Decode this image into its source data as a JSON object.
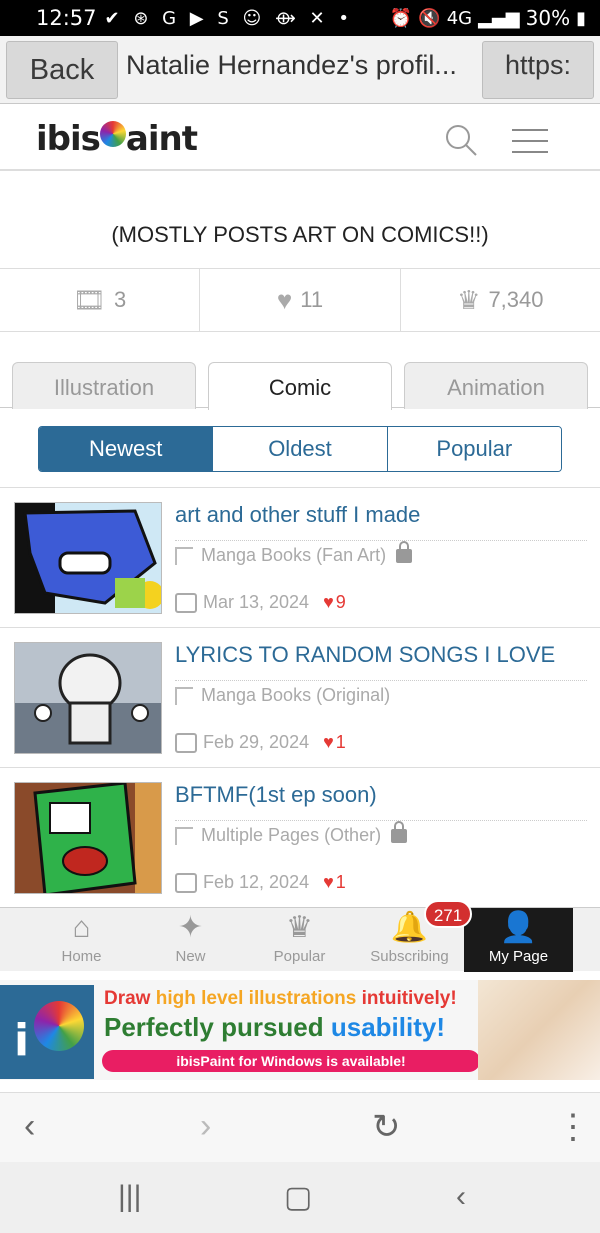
{
  "status": {
    "time": "12:57",
    "signal": "4G",
    "battery": "30%"
  },
  "browser": {
    "back_label": "Back",
    "tab_title": "Natalie Hernandez's profil...",
    "url_label": "https:"
  },
  "site": {
    "logo": "ibisPaint",
    "search_icon": "search-icon",
    "menu_icon": "hamburger-menu-icon"
  },
  "profile": {
    "bio": "(MOSTLY POSTS ART ON COMICS!!)"
  },
  "stats": {
    "works": "3",
    "likes": "11",
    "points": "7,340"
  },
  "tabs": [
    "Illustration",
    "Comic",
    "Animation"
  ],
  "active_tab": "Comic",
  "sorts": [
    "Newest",
    "Oldest",
    "Popular"
  ],
  "active_sort": "Newest",
  "posts": [
    {
      "title": "art and other stuff I made",
      "category": "Manga Books (Fan Art)",
      "locked": true,
      "date": "Mar 13, 2024",
      "likes": "9"
    },
    {
      "title": "LYRICS TO RANDOM SONGS I LOVE",
      "category": "Manga Books (Original)",
      "locked": false,
      "date": "Feb 29, 2024",
      "likes": "1"
    },
    {
      "title": "BFTMF(1st ep soon)",
      "category": "Multiple Pages (Other)",
      "locked": true,
      "date": "Feb 12, 2024",
      "likes": "1"
    }
  ],
  "bottom_nav": {
    "home": "Home",
    "new": "New",
    "popular": "Popular",
    "subscribing": "Subscribing",
    "my_page": "My Page",
    "badge": "271"
  },
  "ad": {
    "line1_a": "Draw ",
    "line1_b": "high level illustrations",
    "line1_c": " intuitively!",
    "line2_a": "Perfectly pursued ",
    "line2_b": "usability!",
    "pill": "ibisPaint for Windows is available!"
  },
  "colors": {
    "accent": "#2c6a96",
    "like": "#e53935",
    "badge": "#d32f2f"
  }
}
